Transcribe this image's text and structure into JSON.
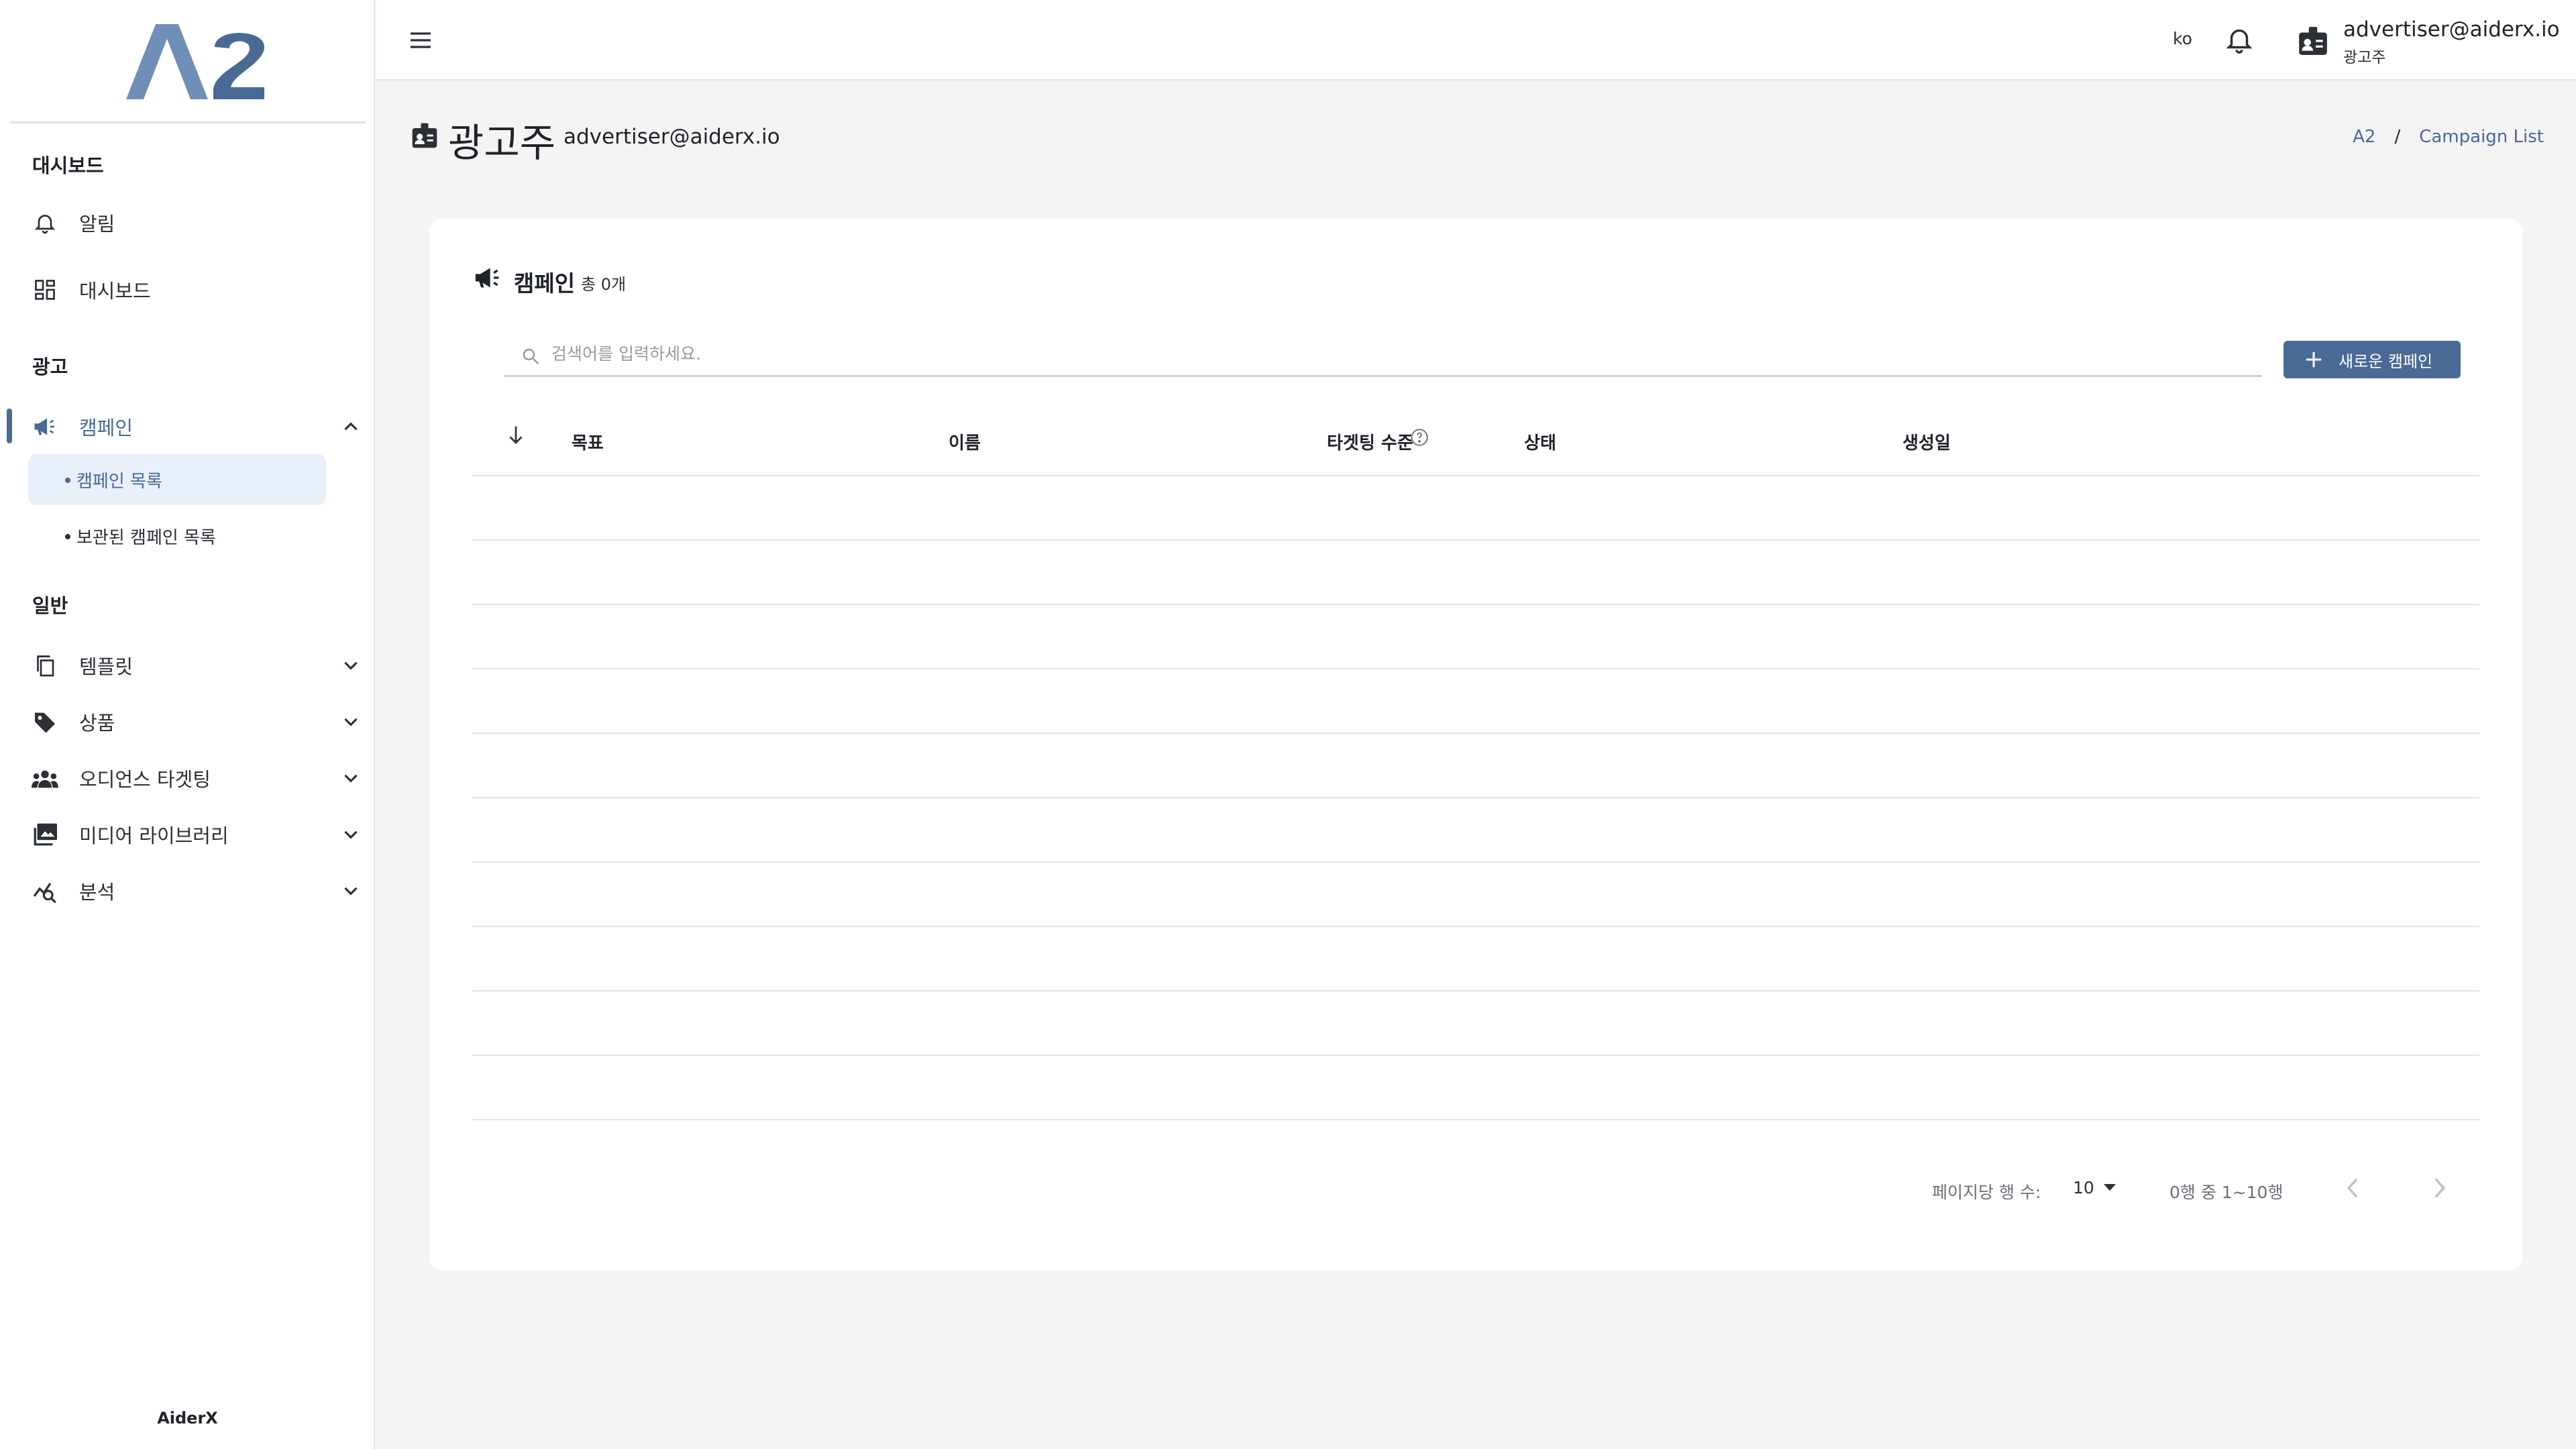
{
  "app": {
    "logo_text": "A2",
    "footer": "AiderX"
  },
  "colors": {
    "accent": "#4a6a96",
    "selected_bg": "#e9f0fa",
    "background": "#f4f4f4"
  },
  "sidebar": {
    "sections": {
      "dashboard": "대시보드",
      "ads": "광고",
      "general": "일반"
    },
    "items": {
      "notifications": {
        "label": "알림",
        "icon": "bell-icon"
      },
      "dashboard": {
        "label": "대시보드",
        "icon": "dashboard-grid-icon"
      },
      "campaign": {
        "label": "캠페인",
        "icon": "megaphone-icon",
        "expanded": true
      },
      "template": {
        "label": "템플릿",
        "icon": "copy-icon"
      },
      "product": {
        "label": "상품",
        "icon": "tag-icon"
      },
      "audience": {
        "label": "오디언스 타겟팅",
        "icon": "people-icon"
      },
      "media": {
        "label": "미디어 라이브러리",
        "icon": "photo-library-icon"
      },
      "analytics": {
        "label": "분석",
        "icon": "analytics-icon"
      }
    },
    "campaign_sub": {
      "list": "캠페인 목록",
      "archived": "보관된 캠페인 목록"
    }
  },
  "topbar": {
    "language": "ko",
    "account_email": "advertiser@aiderx.io",
    "account_role": "광고주"
  },
  "page_header": {
    "title": "광고주",
    "email": "advertiser@aiderx.io",
    "breadcrumb": [
      "A2",
      "Campaign List"
    ],
    "breadcrumb_sep": "/"
  },
  "card": {
    "title": "캠페인",
    "count": "총 0개",
    "search_placeholder": "검색어를 입력하세요.",
    "new_button": "새로운 캠페인",
    "columns": [
      "목표",
      "이름",
      "타겟팅 수준",
      "상태",
      "생성일"
    ],
    "empty_rows": 10
  },
  "pagination": {
    "rows_per_page_label": "페이지당 행 수:",
    "rows_per_page": "10",
    "range": "0행 중 1~10행"
  }
}
